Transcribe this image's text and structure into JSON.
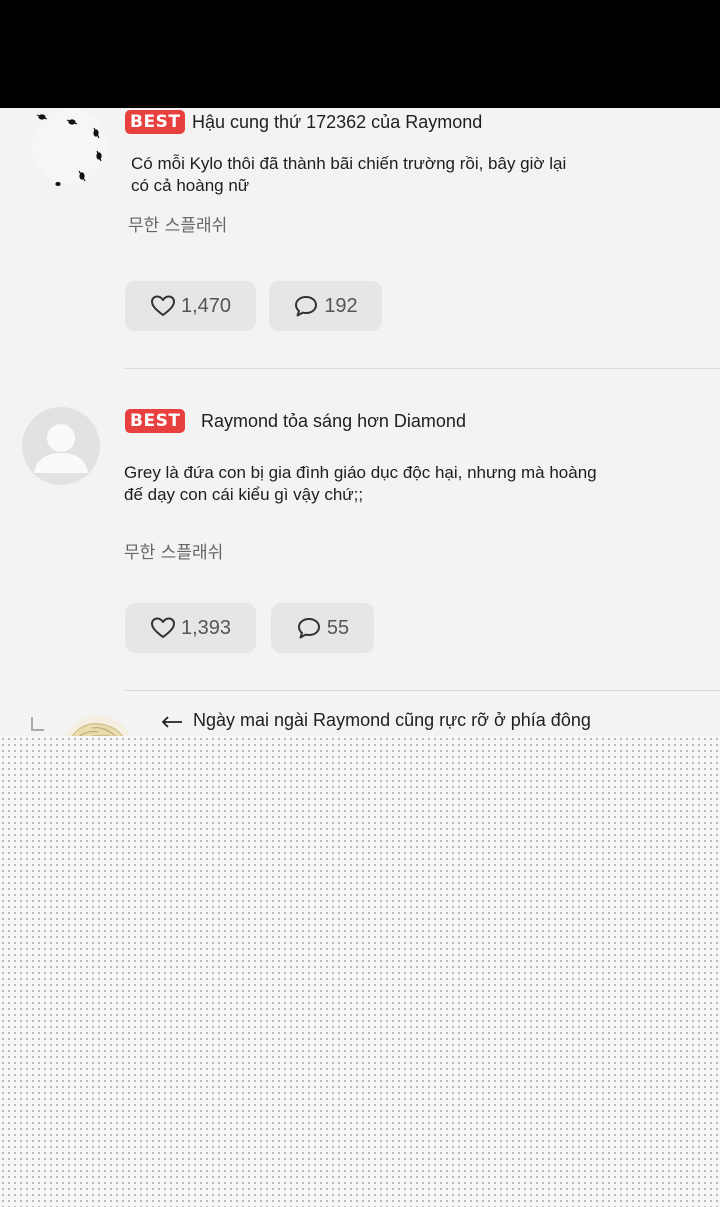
{
  "comments": [
    {
      "badge": "BEST",
      "username": "Hậu cung thứ 172362 của Raymond",
      "text_line1": "Có mỗi Kylo thôi đã thành bãi chiến trường rồi, bây giờ lại",
      "text_line2": "có cả hoàng nữ",
      "series": "무한 스플래쉬",
      "likes": "1,470",
      "replies": "192"
    },
    {
      "badge": "BEST",
      "username": "Raymond tỏa sáng hơn Diamond",
      "text_line1": "Grey là đứa con bị gia đình giáo dục độc hại, nhưng mà hoàng",
      "text_line2": "đế dạy con cái kiểu gì vậy chứ;;",
      "series": "무한 스플래쉬",
      "likes": "1,393",
      "replies": "55"
    },
    {
      "arrow": "←",
      "username": "Ngày mai ngài Raymond cũng rực rỡ ở phía đông"
    }
  ],
  "icons": {
    "like": "heart-icon",
    "reply": "speech-bubble-icon",
    "reply_arrow": "reply-arrow-icon"
  },
  "colors": {
    "badge": "#e8403f",
    "pill": "#e6e6e6",
    "background": "#f3f3f3",
    "topbar": "#000000"
  }
}
